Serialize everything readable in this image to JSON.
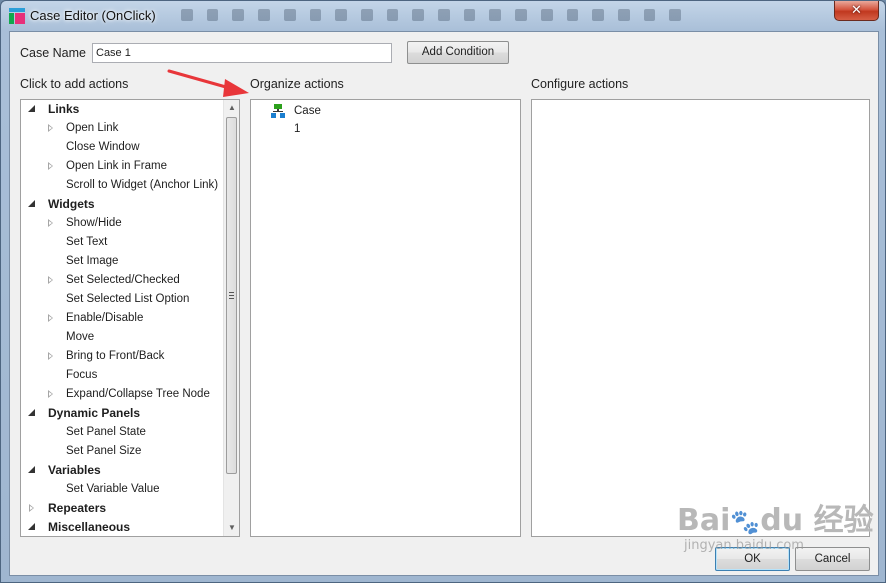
{
  "window": {
    "title": "Case Editor (OnClick)",
    "close_glyph": "✕"
  },
  "case_name": {
    "label": "Case Name",
    "value": "Case 1"
  },
  "add_condition_label": "Add Condition",
  "left_panel": {
    "heading": "Click to add actions",
    "categories": [
      {
        "label": "Links",
        "expanded": true,
        "items": [
          {
            "label": "Open Link",
            "has_children": true
          },
          {
            "label": "Close Window",
            "has_children": false
          },
          {
            "label": "Open Link in Frame",
            "has_children": true
          },
          {
            "label": "Scroll to Widget (Anchor Link)",
            "has_children": false
          }
        ]
      },
      {
        "label": "Widgets",
        "expanded": true,
        "items": [
          {
            "label": "Show/Hide",
            "has_children": true
          },
          {
            "label": "Set Text",
            "has_children": false
          },
          {
            "label": "Set Image",
            "has_children": false
          },
          {
            "label": "Set Selected/Checked",
            "has_children": true
          },
          {
            "label": "Set Selected List Option",
            "has_children": false
          },
          {
            "label": "Enable/Disable",
            "has_children": true
          },
          {
            "label": "Move",
            "has_children": false
          },
          {
            "label": "Bring to Front/Back",
            "has_children": true
          },
          {
            "label": "Focus",
            "has_children": false
          },
          {
            "label": "Expand/Collapse Tree Node",
            "has_children": true
          }
        ]
      },
      {
        "label": "Dynamic Panels",
        "expanded": true,
        "items": [
          {
            "label": "Set Panel State",
            "has_children": false
          },
          {
            "label": "Set Panel Size",
            "has_children": false
          }
        ]
      },
      {
        "label": "Variables",
        "expanded": true,
        "items": [
          {
            "label": "Set Variable Value",
            "has_children": false
          }
        ]
      },
      {
        "label": "Repeaters",
        "expanded": false,
        "items": []
      },
      {
        "label": "Miscellaneous",
        "expanded": true,
        "items": []
      }
    ]
  },
  "middle_panel": {
    "heading": "Organize actions",
    "case_node_label": "Case 1"
  },
  "right_panel": {
    "heading": "Configure actions"
  },
  "footer": {
    "ok_label": "OK",
    "cancel_label": "Cancel"
  },
  "watermark": {
    "text": "Bai du 经验",
    "sub": "jingyan.baidu.com"
  },
  "colors": {
    "annotation_arrow": "#e8363a",
    "title_close": "#c9432a"
  },
  "icons": [
    "app-icon",
    "close-icon",
    "case-node-icon",
    "expand-triangle-icon",
    "collapse-triangle-icon",
    "scroll-up-icon",
    "scroll-down-icon"
  ]
}
